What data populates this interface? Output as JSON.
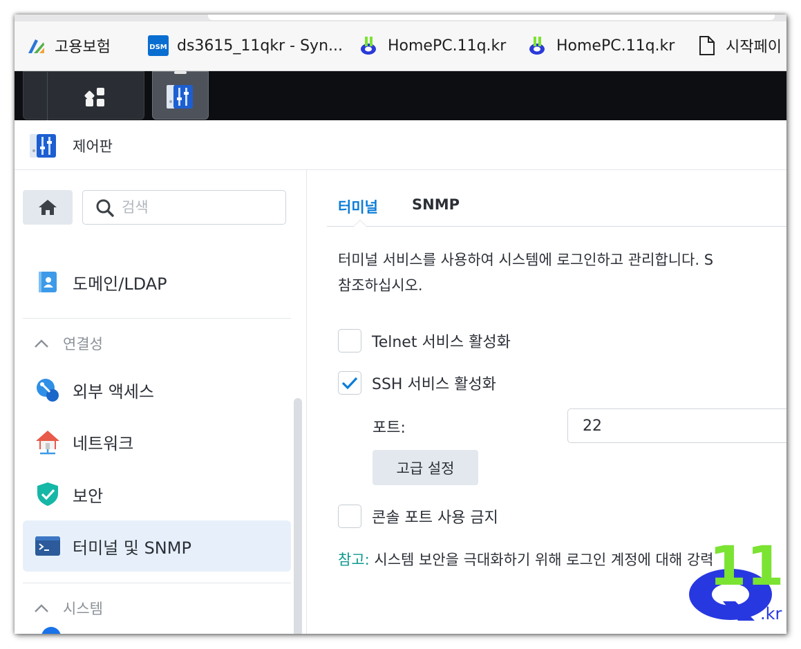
{
  "bookmarks": [
    {
      "label": "고용보험",
      "icon": "ei-logo-icon"
    },
    {
      "label": "ds3615_11qkr - Syn...",
      "icon": "dsm-icon"
    },
    {
      "label": "HomePC.11q.kr",
      "icon": "11q-logo-icon"
    },
    {
      "label": "HomePC.11q.kr",
      "icon": "11q-logo-icon"
    },
    {
      "label": "시작페이",
      "icon": "page-icon"
    }
  ],
  "dsm_badge": "DSM",
  "window": {
    "title": "제어판"
  },
  "sidebar": {
    "search_placeholder": "검색",
    "items": [
      {
        "label": "도메인/LDAP"
      },
      {
        "label": "외부 액세스"
      },
      {
        "label": "네트워크"
      },
      {
        "label": "보안"
      },
      {
        "label": "터미널 및 SNMP"
      }
    ],
    "groups": [
      {
        "label": "연결성"
      },
      {
        "label": "시스템"
      }
    ]
  },
  "main": {
    "tabs": [
      {
        "label": "터미널",
        "active": true
      },
      {
        "label": "SNMP",
        "active": false
      }
    ],
    "description_line1": "터미널 서비스를 사용하여 시스템에 로그인하고 관리합니다. S",
    "description_line2": "참조하십시오.",
    "telnet_label": "Telnet 서비스 활성화",
    "telnet_checked": false,
    "ssh_label": "SSH 서비스 활성화",
    "ssh_checked": true,
    "port_label": "포트:",
    "port_value": "22",
    "advanced_button": "고급 설정",
    "console_label": "콘솔 포트 사용 금지",
    "console_checked": false,
    "note_label": "참고:",
    "note_text": " 시스템 보안을 극대화하기 위해 로그인 계정에 대해 강력"
  },
  "watermark": {
    "text": "11",
    "suffix": ".kr"
  },
  "colors": {
    "accent": "#0a7cd8",
    "note": "#0b9a8d",
    "active_bg": "#e7f0fa"
  }
}
